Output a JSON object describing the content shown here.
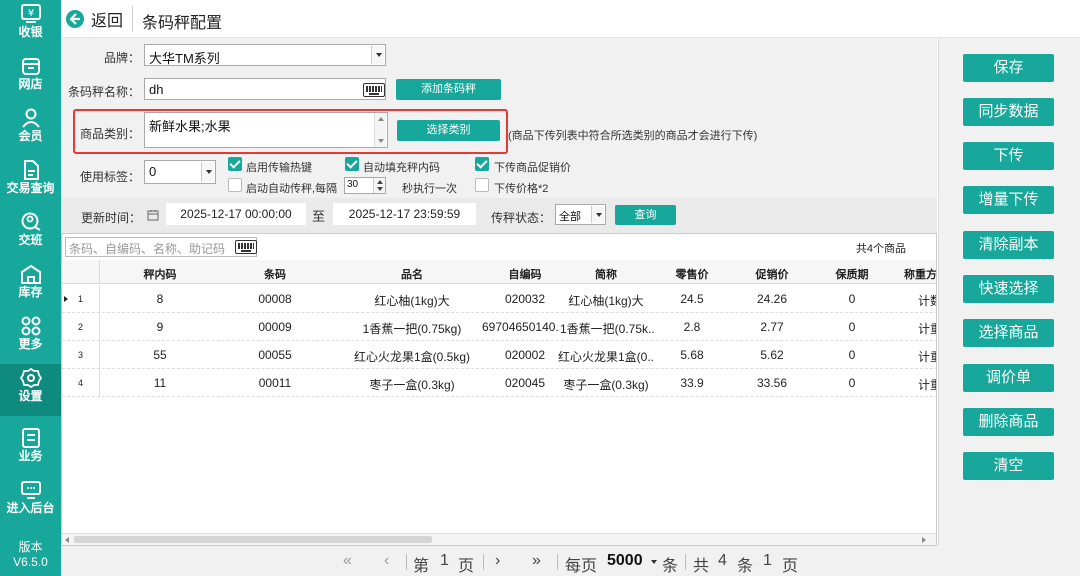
{
  "nav": {
    "items": [
      {
        "label": "收银"
      },
      {
        "label": "网店"
      },
      {
        "label": "会员"
      },
      {
        "label": "交易查询"
      },
      {
        "label": "交班"
      },
      {
        "label": "库存"
      },
      {
        "label": "更多"
      },
      {
        "label": "设置"
      },
      {
        "label": "业务"
      },
      {
        "label": "进入后台"
      }
    ],
    "version_label": "版本",
    "version": "V6.5.0"
  },
  "header": {
    "back_label": "返回",
    "title": "条码秤配置"
  },
  "form": {
    "brand_label": "品牌：",
    "brand_value": "大华TM系列",
    "scale_name_label": "条码秤名称：",
    "scale_name_value": "dh",
    "add_scale_button": "添加条码秤",
    "category_label": "商品类别：",
    "category_value": "新鲜水果;水果",
    "select_category_button": "选择类别",
    "category_note": "(商品下传列表中符合所选类别的商品才会进行下传)",
    "tag_label": "使用标签：",
    "tag_value": "0",
    "options": {
      "hotkey": "启用传输热键",
      "auto_fill": "自动填充秤内码",
      "promo_price": "下传商品促销价",
      "auto_send_prefix": "启动自动传秤,每隔",
      "auto_send_interval": "30",
      "auto_send_suffix": "秒执行一次",
      "price_double": "下传价格*2"
    },
    "update_time_label": "更新时间：",
    "date_from": "2025-12-17 00:00:00",
    "date_to_label": "至",
    "date_to": "2025-12-17 23:59:59",
    "status_label": "传秤状态：",
    "status_value": "全部",
    "query_button": "查询"
  },
  "table": {
    "search_placeholder": "条码、自编码、名称、助记码",
    "count_text": "共4个商品",
    "columns": [
      "秤内码",
      "条码",
      "品名",
      "自编码",
      "简称",
      "零售价",
      "促销价",
      "保质期",
      "称重方"
    ],
    "rows": [
      {
        "num": "1",
        "plu": "8",
        "barcode": "00008",
        "name": "红心柚(1kg)大",
        "code": "020032",
        "short": "红心柚(1kg)大",
        "retail": "24.5",
        "promo": "24.26",
        "shelf": "0",
        "weigh": "计数"
      },
      {
        "num": "2",
        "plu": "9",
        "barcode": "00009",
        "name": "1香蕉一把(0.75kg)",
        "code": "69704650140...",
        "short": "1香蕉一把(0.75k...",
        "retail": "2.8",
        "promo": "2.77",
        "shelf": "0",
        "weigh": "计重"
      },
      {
        "num": "3",
        "plu": "55",
        "barcode": "00055",
        "name": "红心火龙果1盒(0.5kg)",
        "code": "020002",
        "short": "红心火龙果1盒(0....",
        "retail": "5.68",
        "promo": "5.62",
        "shelf": "0",
        "weigh": "计重"
      },
      {
        "num": "4",
        "plu": "11",
        "barcode": "00011",
        "name": "枣子一盒(0.3kg)",
        "code": "020045",
        "short": "枣子一盒(0.3kg)",
        "retail": "33.9",
        "promo": "33.56",
        "shelf": "0",
        "weigh": "计重"
      }
    ]
  },
  "pager": {
    "first": "«",
    "prev": "‹",
    "page_prefix": "第",
    "page": "1",
    "page_suffix": "页",
    "next": "›",
    "last": "»",
    "per_page_prefix": "每页",
    "per_page": "5000",
    "per_page_suffix": "条",
    "total_prefix": "共",
    "total_items": "4",
    "items_unit": "条",
    "total_pages": "1",
    "pages_unit": "页"
  },
  "actions": [
    "保存",
    "同步数据",
    "下传",
    "增量下传",
    "清除副本",
    "快速选择",
    "选择商品",
    "调价单",
    "删除商品",
    "清空"
  ]
}
